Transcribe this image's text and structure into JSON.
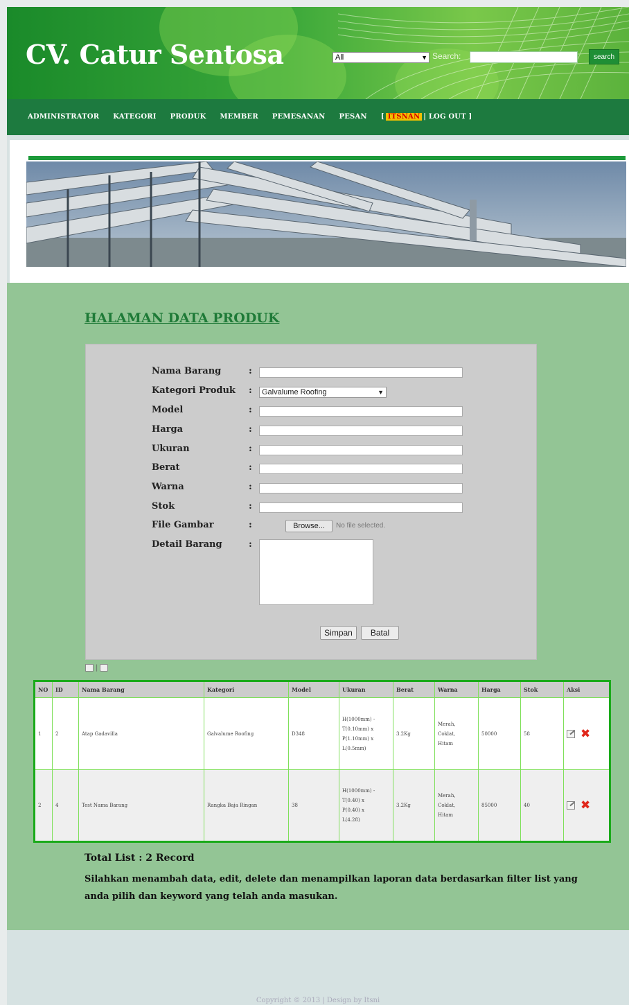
{
  "header": {
    "logo": "CV. Catur Sentosa",
    "search_filter": "All",
    "search_label": "Search:",
    "search_button": "search"
  },
  "nav": {
    "items": [
      "ADMINISTRATOR",
      "KATEGORI",
      "PRODUK",
      "MEMBER",
      "PEMESANAN",
      "PESAN"
    ],
    "bracket_open": "[",
    "user": "ITSNAN",
    "logout": "| LOG OUT ]"
  },
  "page": {
    "title": "HALAMAN DATA PRODUK"
  },
  "form": {
    "colon": ":",
    "fields": {
      "nama": "Nama Barang",
      "kategori": "Kategori Produk",
      "model": "Model",
      "harga": "Harga",
      "ukuran": "Ukuran",
      "berat": "Berat",
      "warna": "Warna",
      "stok": "Stok",
      "file": "File Gambar",
      "detail": "Detail Barang"
    },
    "kategori_value": "Galvalume Roofing",
    "browse_label": "Browse...",
    "file_status": "No file selected.",
    "save_label": "Simpan",
    "cancel_label": "Batal"
  },
  "table": {
    "headers": [
      "NO",
      "ID",
      "Nama Barang",
      "Kategori",
      "Model",
      "Ukuran",
      "Berat",
      "Warna",
      "Harga",
      "Stok",
      "Aksi"
    ],
    "rows": [
      {
        "no": "1",
        "id": "2",
        "nama": "Atap Gadavilla",
        "kategori": "Galvalume Roofing",
        "model": "D348",
        "ukuran": [
          "H(1000mm) -",
          "T(0.10mm) x",
          "P(1.10mm) x",
          "L(0.5mm)"
        ],
        "berat": "3.2Kg",
        "warna": [
          "Merah,",
          "Coklat,",
          "Hitam"
        ],
        "harga": "50000",
        "stok": "58"
      },
      {
        "no": "2",
        "id": "4",
        "nama": "Test Nama Barang",
        "kategori": "Rangka Baja Ringan",
        "model": "38",
        "ukuran": [
          "H(1000mm) -",
          "T(0.40) x",
          "P(0.40) x",
          "L(4.28)"
        ],
        "berat": "3.2Kg",
        "warna": [
          "Merah,",
          "Coklat,",
          "Hitam"
        ],
        "harga": "85000",
        "stok": "40"
      }
    ]
  },
  "summary": {
    "total": "Total List : 2 Record",
    "info": "Silahkan menambah data, edit, delete dan menampilkan laporan data berdasarkan filter list yang anda pilih dan keyword yang telah anda masukan."
  },
  "footer": {
    "copyright": "Copyright © 2013 | Design by Itsni"
  },
  "colors": {
    "header_green": "#3ba83a",
    "nav_green": "#1d7a3f",
    "content_green": "#93c595",
    "table_border": "#1aaa1a",
    "delete_red": "#e0261a"
  }
}
